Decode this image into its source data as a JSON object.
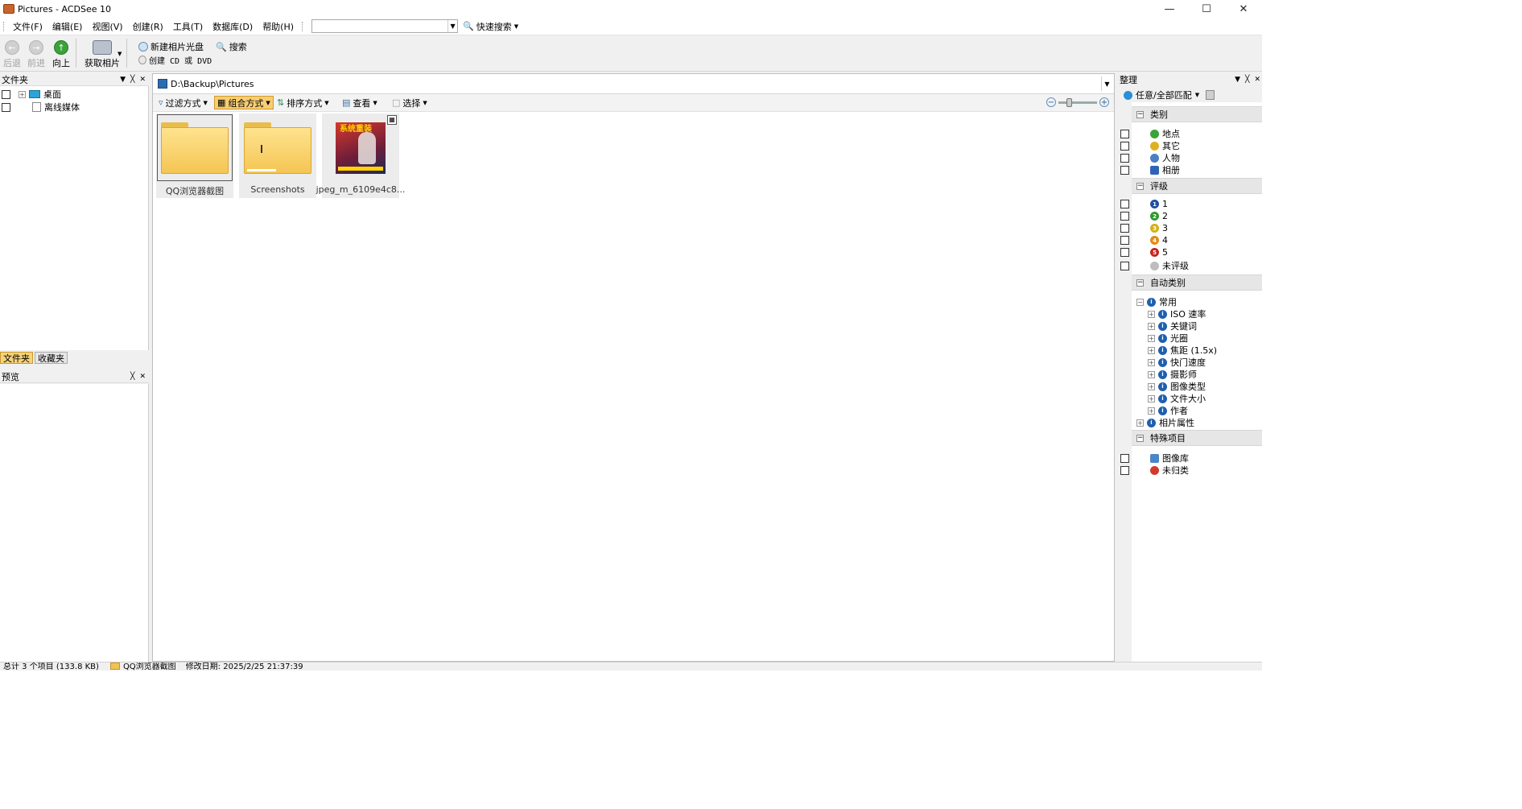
{
  "window": {
    "title": "Pictures - ACDSee 10"
  },
  "menu": {
    "items": [
      "文件(F)",
      "编辑(E)",
      "视图(V)",
      "创建(R)",
      "工具(T)",
      "数据库(D)",
      "帮助(H)"
    ],
    "quick_search": "快速搜索",
    "search_value": ""
  },
  "toolbar": {
    "back": "后退",
    "forward": "前进",
    "up": "向上",
    "acquire": "获取相片",
    "new_photo_disc": "新建相片光盘",
    "search": "搜索",
    "create_cd": "创建 CD 或 DVD"
  },
  "left": {
    "folders_title": "文件夹",
    "tree": [
      "桌面",
      "离线媒体"
    ],
    "tabs": [
      "文件夹",
      "收藏夹"
    ],
    "preview_title": "预览"
  },
  "browser": {
    "path": "D:\\Backup\\Pictures",
    "filter": "过滤方式",
    "group": "组合方式",
    "sort": "排序方式",
    "view": "查看",
    "select": "选择",
    "items": [
      {
        "name": "QQ浏览器截图",
        "type": "folder",
        "selected": true
      },
      {
        "name": "Screenshots",
        "type": "folder",
        "selected": false
      },
      {
        "name": "jpeg_m_6109e4c8...",
        "type": "image",
        "selected": false,
        "poster_text": "系统重装"
      }
    ]
  },
  "organize": {
    "title": "整理",
    "match": "任意/全部匹配",
    "sections": {
      "categories": "类别",
      "ratings": "评级",
      "auto": "自动类别",
      "special": "特殊项目"
    },
    "categories": [
      "地点",
      "其它",
      "人物",
      "相册"
    ],
    "ratings": [
      "1",
      "2",
      "3",
      "4",
      "5",
      "未评级"
    ],
    "auto": {
      "root": "常用",
      "children": [
        "ISO 速率",
        "关键词",
        "光圈",
        "焦距 (1.5x)",
        "快门速度",
        "摄影师",
        "图像类型",
        "文件大小",
        "作者"
      ],
      "photo_props": "相片属性"
    },
    "special": [
      "图像库",
      "未归类"
    ]
  },
  "status": {
    "total": "总计 3 个项目 (133.8 KB)",
    "current": "QQ浏览器截图",
    "modified": "修改日期: 2025/2/25 21:37:39"
  }
}
